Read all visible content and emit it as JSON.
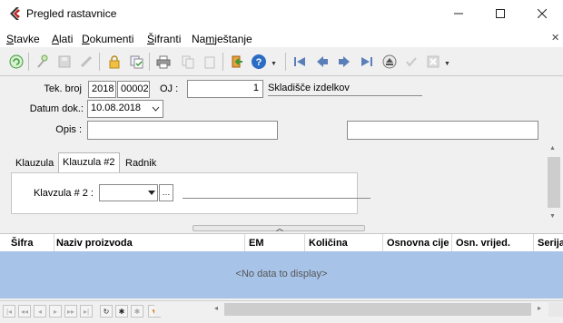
{
  "window": {
    "title": "Pregled rastavnice"
  },
  "menu": {
    "stavke": {
      "u": "S",
      "rest": "tavke"
    },
    "alati": {
      "u": "A",
      "rest": "lati"
    },
    "dokumenti": {
      "u": "D",
      "rest": "okumenti"
    },
    "sifranti": {
      "u": "Š",
      "rest": "ifranti"
    },
    "namjestanje": {
      "pre": "Na",
      "u": "m",
      "rest": "ještanje"
    }
  },
  "form": {
    "tek_broj_label": "Tek. broj",
    "tek_broj_year": "2018",
    "tek_broj_number": "00002",
    "oj_label": "OJ :",
    "oj_value": "1",
    "oj_name": "Skladišče izdelkov",
    "datum_label": "Datum dok.:",
    "datum_value": "10.08.2018",
    "opis_label": "Opis :"
  },
  "tabs": {
    "klauzula": "Klauzula",
    "klauzula_2": "Klauzula #2",
    "radnik": "Radnik",
    "klauzula_2_label": "Klavzula # 2 :"
  },
  "grid": {
    "columns": [
      "Šifra",
      "Naziv proizvoda",
      "EM",
      "Količina",
      "Osnovna cije",
      "Osn. vrijed.",
      "Serija"
    ],
    "empty_text": "<No data to display>"
  },
  "colors": {
    "grid_body": "#a7c4e8",
    "accent_green": "#3a9a3a",
    "help_blue": "#2b6cc4"
  }
}
